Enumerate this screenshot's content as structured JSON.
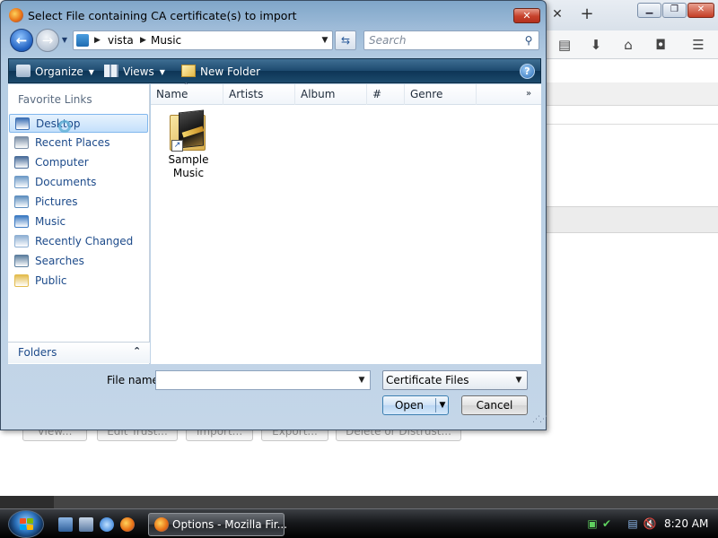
{
  "firefox": {
    "tab_close": "✕",
    "tab_new": "+",
    "window_min": "▁",
    "window_max": "❐",
    "window_close": "✕",
    "toolbar_icons": [
      "reader-list-icon",
      "download-icon",
      "home-icon",
      "pocket-icon",
      "menu-icon"
    ],
    "buttons": [
      "View...",
      "Edit Trust...",
      "Import...",
      "Export...",
      "Delete or Distrust..."
    ]
  },
  "dialog": {
    "title": "Select File containing CA certificate(s) to import",
    "close": "✕",
    "address": {
      "crumbs": [
        "vista",
        "Music"
      ]
    },
    "search_placeholder": "Search",
    "commands": {
      "organize": "Organize",
      "views": "Views",
      "new_folder": "New Folder",
      "help": "?"
    },
    "nav": {
      "heading": "Favorite Links",
      "items": [
        {
          "label": "Desktop",
          "icon": "desktop-icon",
          "color": "#3b6fb5"
        },
        {
          "label": "Recent Places",
          "icon": "recent-places-icon",
          "color": "#7a8ea6"
        },
        {
          "label": "Computer",
          "icon": "computer-icon",
          "color": "#4a6d9a"
        },
        {
          "label": "Documents",
          "icon": "documents-icon",
          "color": "#6f9bc7"
        },
        {
          "label": "Pictures",
          "icon": "pictures-icon",
          "color": "#5f8fbf"
        },
        {
          "label": "Music",
          "icon": "music-icon",
          "color": "#3c7ac2"
        },
        {
          "label": "Recently Changed",
          "icon": "recently-changed-icon",
          "color": "#8fb0d3"
        },
        {
          "label": "Searches",
          "icon": "searches-icon",
          "color": "#5d7f9f"
        },
        {
          "label": "Public",
          "icon": "public-folder-icon",
          "color": "#e3bc4e"
        }
      ],
      "selected_index": 0,
      "folders_label": "Folders"
    },
    "columns": [
      "Name",
      "Artists",
      "Album",
      "#",
      "Genre"
    ],
    "files": [
      {
        "label": "Sample Music",
        "icon": "music-folder-icon"
      }
    ],
    "file_name_label": "File name:",
    "file_name_value": "",
    "filter": "Certificate Files",
    "open_label": "Open",
    "cancel_label": "Cancel"
  },
  "taskbar": {
    "task_label": "Options - Mozilla Fir...",
    "clock": "8:20 AM"
  }
}
